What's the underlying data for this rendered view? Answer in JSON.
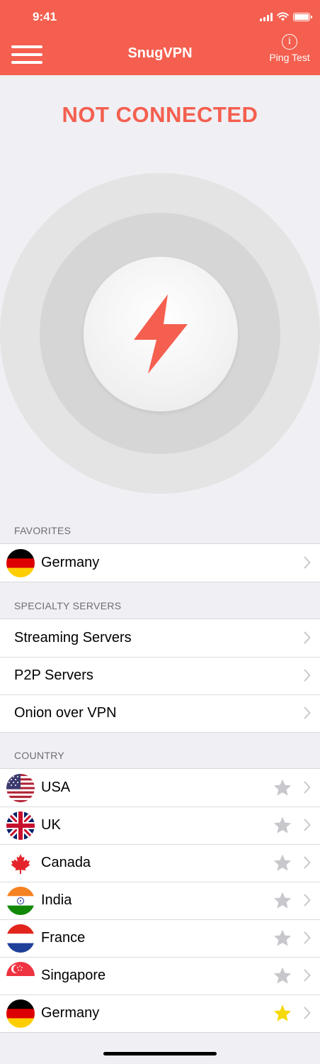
{
  "status_bar": {
    "time": "9:41"
  },
  "header": {
    "title": "SnugVPN",
    "ping_label": "Ping Test",
    "info_glyph": "i"
  },
  "connection": {
    "status": "NOT CONNECTED"
  },
  "favorites": {
    "title": "FAVORITES",
    "items": [
      {
        "label": "Germany",
        "flag": "germany-flag-icon"
      }
    ]
  },
  "specialty": {
    "title": "SPECIALTY SERVERS",
    "items": [
      {
        "label": "Streaming Servers"
      },
      {
        "label": "P2P Servers"
      },
      {
        "label": "Onion over VPN"
      }
    ]
  },
  "country": {
    "title": "COUNTRY",
    "items": [
      {
        "label": "USA",
        "flag": "usa-flag-icon",
        "favorite": false
      },
      {
        "label": "UK",
        "flag": "uk-flag-icon",
        "favorite": false
      },
      {
        "label": "Canada",
        "flag": "canada-flag-icon",
        "favorite": false
      },
      {
        "label": "India",
        "flag": "india-flag-icon",
        "favorite": false
      },
      {
        "label": "France",
        "flag": "france-flag-icon",
        "favorite": false
      },
      {
        "label": "Singapore",
        "flag": "singapore-flag-icon",
        "favorite": false
      },
      {
        "label": "Germany",
        "flag": "germany-flag-icon",
        "favorite": true
      }
    ]
  },
  "colors": {
    "accent": "#f45f4f",
    "star_inactive": "#c7c7cc",
    "star_active": "#f5d90a",
    "chevron": "#c7c7cc"
  }
}
